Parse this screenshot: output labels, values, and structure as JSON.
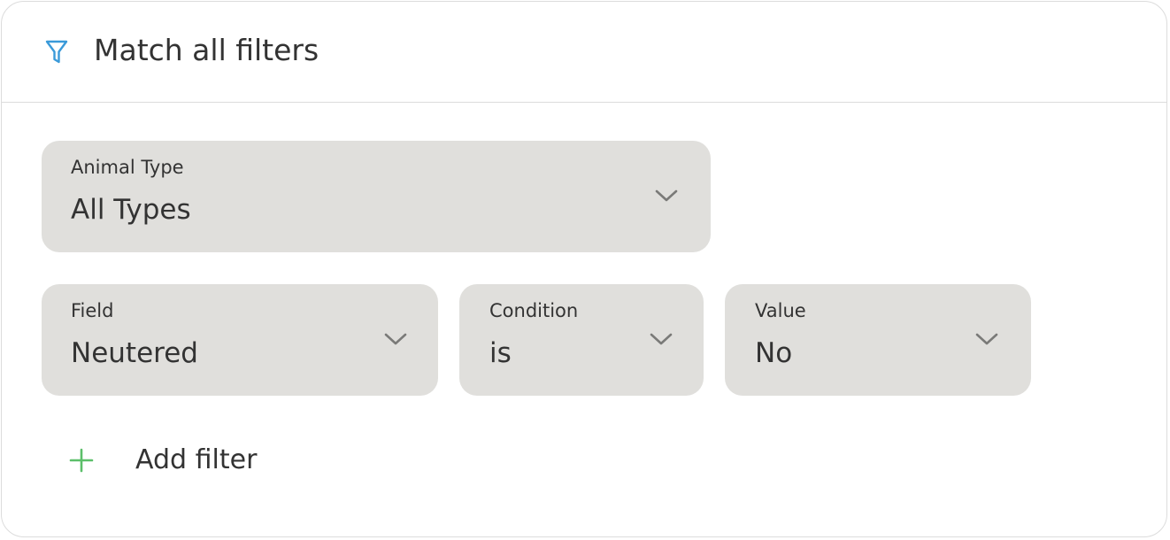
{
  "header": {
    "title": "Match all filters",
    "icon": "filter-icon"
  },
  "filters": {
    "animal_type": {
      "label": "Animal Type",
      "value": "All Types"
    },
    "field": {
      "label": "Field",
      "value": "Neutered"
    },
    "condition": {
      "label": "Condition",
      "value": "is"
    },
    "value": {
      "label": "Value",
      "value": "No"
    }
  },
  "add_filter": {
    "label": "Add filter",
    "icon": "plus-icon"
  },
  "colors": {
    "accent_icon": "#3a9ad9",
    "add_icon": "#5cbf6a",
    "select_bg": "#e0dfdc",
    "text": "#333333",
    "chevron": "#7a7a78",
    "border": "#dcdcdc"
  }
}
